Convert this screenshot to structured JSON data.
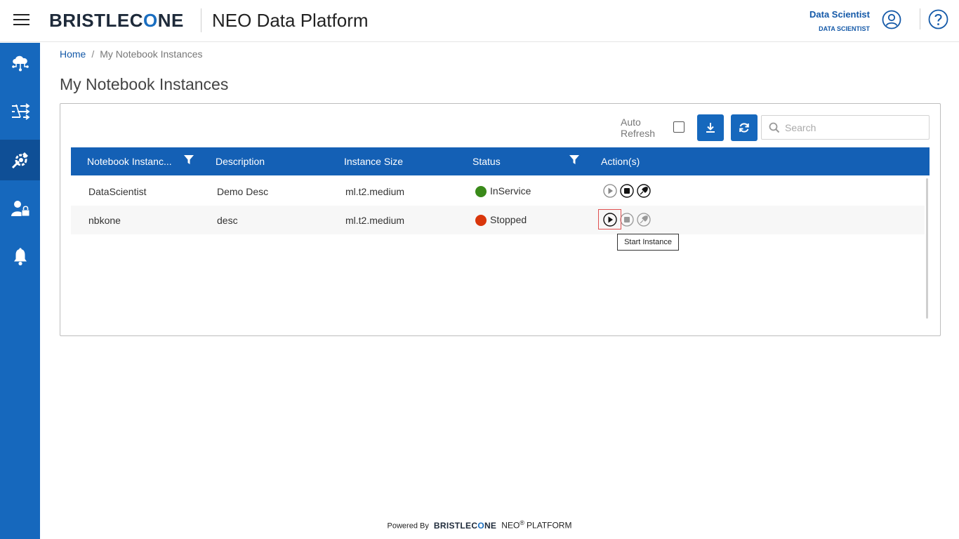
{
  "header": {
    "logo_a": "BRISTLEC",
    "logo_b": "O",
    "logo_c": "NE",
    "platform_title": "NEO Data Platform",
    "user_name": "Data Scientist",
    "user_role": "DATA SCIENTIST"
  },
  "sidebar": {
    "items": [
      {
        "icon": "cloud-network-icon",
        "active": false
      },
      {
        "icon": "pipeline-icon",
        "active": false
      },
      {
        "icon": "tools-icon",
        "active": true
      },
      {
        "icon": "user-admin-icon",
        "active": false
      },
      {
        "icon": "bell-icon",
        "active": false
      }
    ]
  },
  "breadcrumb": {
    "home": "Home",
    "separator": "/",
    "current": "My Notebook Instances"
  },
  "page": {
    "title": "My Notebook Instances"
  },
  "toolbar": {
    "auto_refresh_label": "Auto Refresh",
    "auto_refresh_checked": false,
    "search_placeholder": "Search"
  },
  "table": {
    "columns": [
      "Notebook Instanc...",
      "Description",
      "Instance Size",
      "Status",
      "Action(s)"
    ],
    "rows": [
      {
        "name": "DataScientist",
        "description": "Demo Desc",
        "size": "ml.t2.medium",
        "status": "InService",
        "status_color": "#3a8a1a"
      },
      {
        "name": "nbkone",
        "description": "desc",
        "size": "ml.t2.medium",
        "status": "Stopped",
        "status_color": "#d9360b"
      }
    ]
  },
  "tooltip": {
    "text": "Start Instance"
  },
  "footer": {
    "powered_by": "Powered By",
    "brand_a": "BRISTLEC",
    "brand_b": "O",
    "brand_c": "NE",
    "neo": "NEO",
    "reg": "®",
    "platform": "PLATFORM"
  }
}
